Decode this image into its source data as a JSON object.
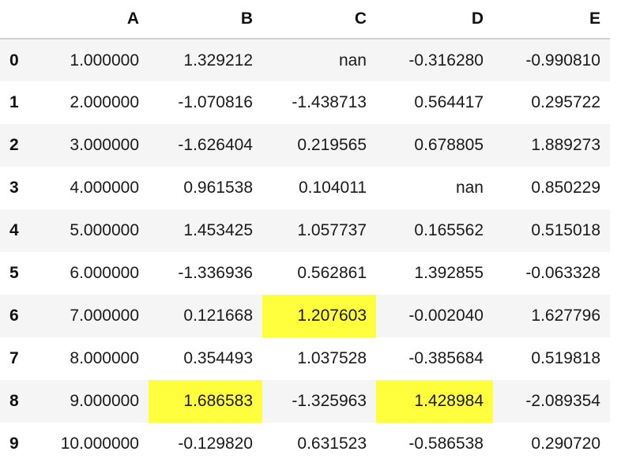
{
  "table": {
    "columns": [
      "A",
      "B",
      "C",
      "D",
      "E"
    ],
    "highlight_color": "#ffff3d",
    "rows": [
      {
        "index": "0",
        "cells": [
          {
            "v": "1.000000"
          },
          {
            "v": "1.329212"
          },
          {
            "v": "nan"
          },
          {
            "v": "-0.316280"
          },
          {
            "v": "-0.990810"
          }
        ]
      },
      {
        "index": "1",
        "cells": [
          {
            "v": "2.000000"
          },
          {
            "v": "-1.070816"
          },
          {
            "v": "-1.438713"
          },
          {
            "v": "0.564417"
          },
          {
            "v": "0.295722"
          }
        ]
      },
      {
        "index": "2",
        "cells": [
          {
            "v": "3.000000"
          },
          {
            "v": "-1.626404"
          },
          {
            "v": "0.219565"
          },
          {
            "v": "0.678805"
          },
          {
            "v": "1.889273"
          }
        ]
      },
      {
        "index": "3",
        "cells": [
          {
            "v": "4.000000"
          },
          {
            "v": "0.961538"
          },
          {
            "v": "0.104011"
          },
          {
            "v": "nan"
          },
          {
            "v": "0.850229"
          }
        ]
      },
      {
        "index": "4",
        "cells": [
          {
            "v": "5.000000"
          },
          {
            "v": "1.453425"
          },
          {
            "v": "1.057737"
          },
          {
            "v": "0.165562"
          },
          {
            "v": "0.515018"
          }
        ]
      },
      {
        "index": "5",
        "cells": [
          {
            "v": "6.000000"
          },
          {
            "v": "-1.336936"
          },
          {
            "v": "0.562861"
          },
          {
            "v": "1.392855"
          },
          {
            "v": "-0.063328"
          }
        ]
      },
      {
        "index": "6",
        "cells": [
          {
            "v": "7.000000"
          },
          {
            "v": "0.121668"
          },
          {
            "v": "1.207603",
            "highlight": true
          },
          {
            "v": "-0.002040"
          },
          {
            "v": "1.627796"
          }
        ]
      },
      {
        "index": "7",
        "cells": [
          {
            "v": "8.000000"
          },
          {
            "v": "0.354493"
          },
          {
            "v": "1.037528"
          },
          {
            "v": "-0.385684"
          },
          {
            "v": "0.519818"
          }
        ]
      },
      {
        "index": "8",
        "cells": [
          {
            "v": "9.000000"
          },
          {
            "v": "1.686583",
            "highlight": true
          },
          {
            "v": "-1.325963"
          },
          {
            "v": "1.428984",
            "highlight": true
          },
          {
            "v": "-2.089354"
          }
        ]
      },
      {
        "index": "9",
        "cells": [
          {
            "v": "10.000000"
          },
          {
            "v": "-0.129820"
          },
          {
            "v": "0.631523"
          },
          {
            "v": "-0.586538"
          },
          {
            "v": "0.290720"
          }
        ]
      }
    ]
  }
}
